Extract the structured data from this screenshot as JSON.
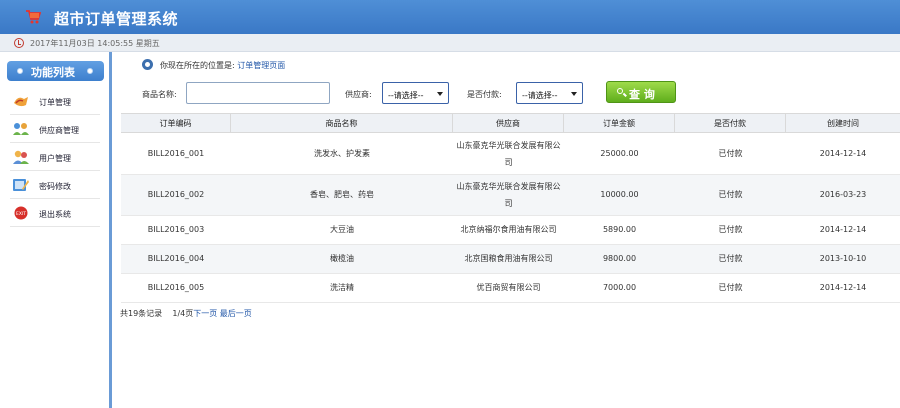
{
  "header": {
    "title": "超市订单管理系统"
  },
  "datebar": {
    "date": "2017年11月03日 14:05:55 星期五"
  },
  "sidebar": {
    "title": "功能列表",
    "items": [
      {
        "label": "订单管理",
        "icon": "order-icon"
      },
      {
        "label": "供应商管理",
        "icon": "supplier-icon"
      },
      {
        "label": "用户管理",
        "icon": "users-icon"
      },
      {
        "label": "密码修改",
        "icon": "password-icon"
      },
      {
        "label": "退出系统",
        "icon": "exit-icon",
        "badge": "EXIT"
      }
    ]
  },
  "location": {
    "prefix": "你现在所在的位置是:",
    "current": "订单管理页面"
  },
  "search": {
    "product_label": "商品名称:",
    "product_value": "",
    "supplier_label": "供应商:",
    "supplier_value": "--请选择--",
    "paid_label": "是否付款:",
    "paid_value": "--请选择--",
    "query_button": "查 询"
  },
  "table": {
    "columns": [
      "订单编码",
      "商品名称",
      "供应商",
      "订单金额",
      "是否付款",
      "创建时间"
    ],
    "rows": [
      [
        "BILL2016_001",
        "洗发水、护发素",
        "山东豪克华光联合发展有限公司",
        "25000.00",
        "已付款",
        "2014-12-14"
      ],
      [
        "BILL2016_002",
        "香皂、肥皂、药皂",
        "山东豪克华光联合发展有限公司",
        "10000.00",
        "已付款",
        "2016-03-23"
      ],
      [
        "BILL2016_003",
        "大豆油",
        "北京纳福尔食用油有限公司",
        "5890.00",
        "已付款",
        "2014-12-14"
      ],
      [
        "BILL2016_004",
        "橄榄油",
        "北京国粮食用油有限公司",
        "9800.00",
        "已付款",
        "2013-10-10"
      ],
      [
        "BILL2016_005",
        "洗洁精",
        "优百商贸有限公司",
        "7000.00",
        "已付款",
        "2014-12-14"
      ]
    ]
  },
  "footer": {
    "total": "共19条记录",
    "page": "1/4页",
    "next": "下一页",
    "last": "最后一页"
  },
  "colors": {
    "header": "#3a78c6",
    "accent_green": "#5fae1c",
    "link": "#2257a8"
  }
}
